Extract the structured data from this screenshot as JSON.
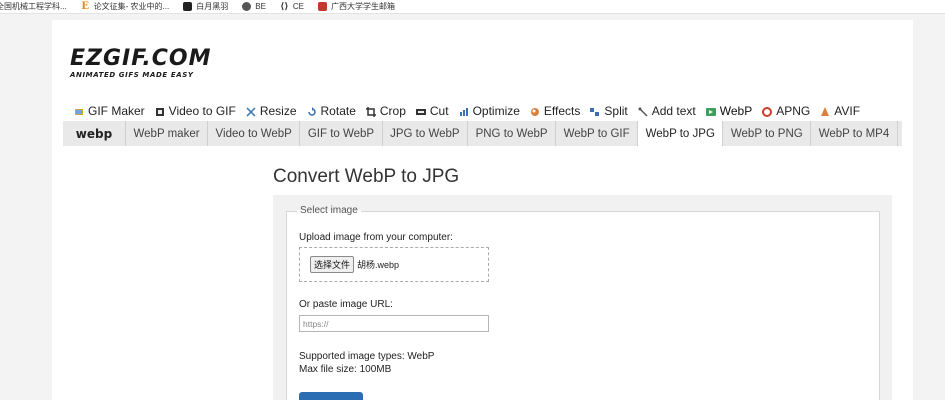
{
  "bookmarks": [
    {
      "label": "全国机械工程学科...",
      "icon": "blank"
    },
    {
      "label": "论文征集- 农业中的...",
      "icon": "letter-e-icon",
      "icon_text": "E",
      "color": "#e08a1e"
    },
    {
      "label": "白月黑羽",
      "icon": "square-logo-icon",
      "color": "#222222"
    },
    {
      "label": "BE",
      "icon": "globe-icon",
      "color": "#555555"
    },
    {
      "label": "CE",
      "icon": "ce-logo-icon",
      "color": "#333333"
    },
    {
      "label": "广西大学学生邮箱",
      "icon": "mail-logo-icon",
      "color": "#c0392b"
    }
  ],
  "logo": {
    "main": "EZGIF.COM",
    "sub": "ANIMATED GIFS MADE EASY"
  },
  "main_nav": [
    {
      "label": "GIF Maker",
      "icon": "gif-maker-icon"
    },
    {
      "label": "Video to GIF",
      "icon": "film-icon"
    },
    {
      "label": "Resize",
      "icon": "resize-icon"
    },
    {
      "label": "Rotate",
      "icon": "rotate-icon"
    },
    {
      "label": "Crop",
      "icon": "crop-icon"
    },
    {
      "label": "Cut",
      "icon": "cut-icon"
    },
    {
      "label": "Optimize",
      "icon": "optimize-icon"
    },
    {
      "label": "Effects",
      "icon": "effects-icon"
    },
    {
      "label": "Split",
      "icon": "split-icon"
    },
    {
      "label": "Add text",
      "icon": "add-text-icon"
    },
    {
      "label": "WebP",
      "icon": "webp-icon",
      "active": true
    },
    {
      "label": "APNG",
      "icon": "apng-icon"
    },
    {
      "label": "AVIF",
      "icon": "avif-icon"
    }
  ],
  "sub_nav": {
    "logo": "webp",
    "items": [
      {
        "label": "WebP maker"
      },
      {
        "label": "Video to WebP"
      },
      {
        "label": "GIF to WebP"
      },
      {
        "label": "JPG to WebP"
      },
      {
        "label": "PNG to WebP"
      },
      {
        "label": "WebP to GIF"
      },
      {
        "label": "WebP to JPG",
        "active": true
      },
      {
        "label": "WebP to PNG"
      },
      {
        "label": "WebP to MP4"
      }
    ]
  },
  "page_title": "Convert WebP to JPG",
  "form": {
    "legend": "Select image",
    "upload_label": "Upload image from your computer:",
    "file_button": "选择文件",
    "file_name": "胡杨.webp",
    "url_label": "Or paste image URL:",
    "url_placeholder": "https://",
    "supported": "Supported image types: WebP",
    "max_size": "Max file size: 100MB"
  },
  "colors": {
    "accent": "#2b6db3",
    "subnav_bg": "#e9e9e9"
  }
}
